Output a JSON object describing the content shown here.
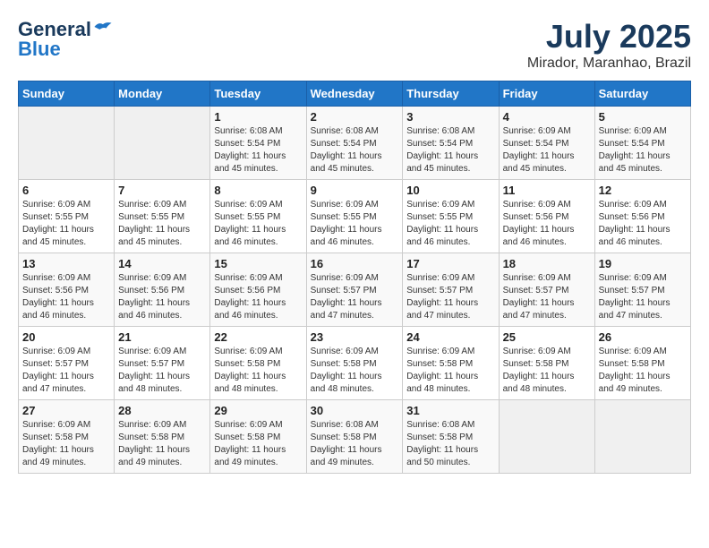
{
  "header": {
    "logo_line1": "General",
    "logo_line2": "Blue",
    "title": "July 2025",
    "subtitle": "Mirador, Maranhao, Brazil"
  },
  "days_of_week": [
    "Sunday",
    "Monday",
    "Tuesday",
    "Wednesday",
    "Thursday",
    "Friday",
    "Saturday"
  ],
  "weeks": [
    [
      {
        "day": "",
        "info": ""
      },
      {
        "day": "",
        "info": ""
      },
      {
        "day": "1",
        "info": "Sunrise: 6:08 AM\nSunset: 5:54 PM\nDaylight: 11 hours and 45 minutes."
      },
      {
        "day": "2",
        "info": "Sunrise: 6:08 AM\nSunset: 5:54 PM\nDaylight: 11 hours and 45 minutes."
      },
      {
        "day": "3",
        "info": "Sunrise: 6:08 AM\nSunset: 5:54 PM\nDaylight: 11 hours and 45 minutes."
      },
      {
        "day": "4",
        "info": "Sunrise: 6:09 AM\nSunset: 5:54 PM\nDaylight: 11 hours and 45 minutes."
      },
      {
        "day": "5",
        "info": "Sunrise: 6:09 AM\nSunset: 5:54 PM\nDaylight: 11 hours and 45 minutes."
      }
    ],
    [
      {
        "day": "6",
        "info": "Sunrise: 6:09 AM\nSunset: 5:55 PM\nDaylight: 11 hours and 45 minutes."
      },
      {
        "day": "7",
        "info": "Sunrise: 6:09 AM\nSunset: 5:55 PM\nDaylight: 11 hours and 45 minutes."
      },
      {
        "day": "8",
        "info": "Sunrise: 6:09 AM\nSunset: 5:55 PM\nDaylight: 11 hours and 46 minutes."
      },
      {
        "day": "9",
        "info": "Sunrise: 6:09 AM\nSunset: 5:55 PM\nDaylight: 11 hours and 46 minutes."
      },
      {
        "day": "10",
        "info": "Sunrise: 6:09 AM\nSunset: 5:55 PM\nDaylight: 11 hours and 46 minutes."
      },
      {
        "day": "11",
        "info": "Sunrise: 6:09 AM\nSunset: 5:56 PM\nDaylight: 11 hours and 46 minutes."
      },
      {
        "day": "12",
        "info": "Sunrise: 6:09 AM\nSunset: 5:56 PM\nDaylight: 11 hours and 46 minutes."
      }
    ],
    [
      {
        "day": "13",
        "info": "Sunrise: 6:09 AM\nSunset: 5:56 PM\nDaylight: 11 hours and 46 minutes."
      },
      {
        "day": "14",
        "info": "Sunrise: 6:09 AM\nSunset: 5:56 PM\nDaylight: 11 hours and 46 minutes."
      },
      {
        "day": "15",
        "info": "Sunrise: 6:09 AM\nSunset: 5:56 PM\nDaylight: 11 hours and 46 minutes."
      },
      {
        "day": "16",
        "info": "Sunrise: 6:09 AM\nSunset: 5:57 PM\nDaylight: 11 hours and 47 minutes."
      },
      {
        "day": "17",
        "info": "Sunrise: 6:09 AM\nSunset: 5:57 PM\nDaylight: 11 hours and 47 minutes."
      },
      {
        "day": "18",
        "info": "Sunrise: 6:09 AM\nSunset: 5:57 PM\nDaylight: 11 hours and 47 minutes."
      },
      {
        "day": "19",
        "info": "Sunrise: 6:09 AM\nSunset: 5:57 PM\nDaylight: 11 hours and 47 minutes."
      }
    ],
    [
      {
        "day": "20",
        "info": "Sunrise: 6:09 AM\nSunset: 5:57 PM\nDaylight: 11 hours and 47 minutes."
      },
      {
        "day": "21",
        "info": "Sunrise: 6:09 AM\nSunset: 5:57 PM\nDaylight: 11 hours and 48 minutes."
      },
      {
        "day": "22",
        "info": "Sunrise: 6:09 AM\nSunset: 5:58 PM\nDaylight: 11 hours and 48 minutes."
      },
      {
        "day": "23",
        "info": "Sunrise: 6:09 AM\nSunset: 5:58 PM\nDaylight: 11 hours and 48 minutes."
      },
      {
        "day": "24",
        "info": "Sunrise: 6:09 AM\nSunset: 5:58 PM\nDaylight: 11 hours and 48 minutes."
      },
      {
        "day": "25",
        "info": "Sunrise: 6:09 AM\nSunset: 5:58 PM\nDaylight: 11 hours and 48 minutes."
      },
      {
        "day": "26",
        "info": "Sunrise: 6:09 AM\nSunset: 5:58 PM\nDaylight: 11 hours and 49 minutes."
      }
    ],
    [
      {
        "day": "27",
        "info": "Sunrise: 6:09 AM\nSunset: 5:58 PM\nDaylight: 11 hours and 49 minutes."
      },
      {
        "day": "28",
        "info": "Sunrise: 6:09 AM\nSunset: 5:58 PM\nDaylight: 11 hours and 49 minutes."
      },
      {
        "day": "29",
        "info": "Sunrise: 6:09 AM\nSunset: 5:58 PM\nDaylight: 11 hours and 49 minutes."
      },
      {
        "day": "30",
        "info": "Sunrise: 6:08 AM\nSunset: 5:58 PM\nDaylight: 11 hours and 49 minutes."
      },
      {
        "day": "31",
        "info": "Sunrise: 6:08 AM\nSunset: 5:58 PM\nDaylight: 11 hours and 50 minutes."
      },
      {
        "day": "",
        "info": ""
      },
      {
        "day": "",
        "info": ""
      }
    ]
  ]
}
